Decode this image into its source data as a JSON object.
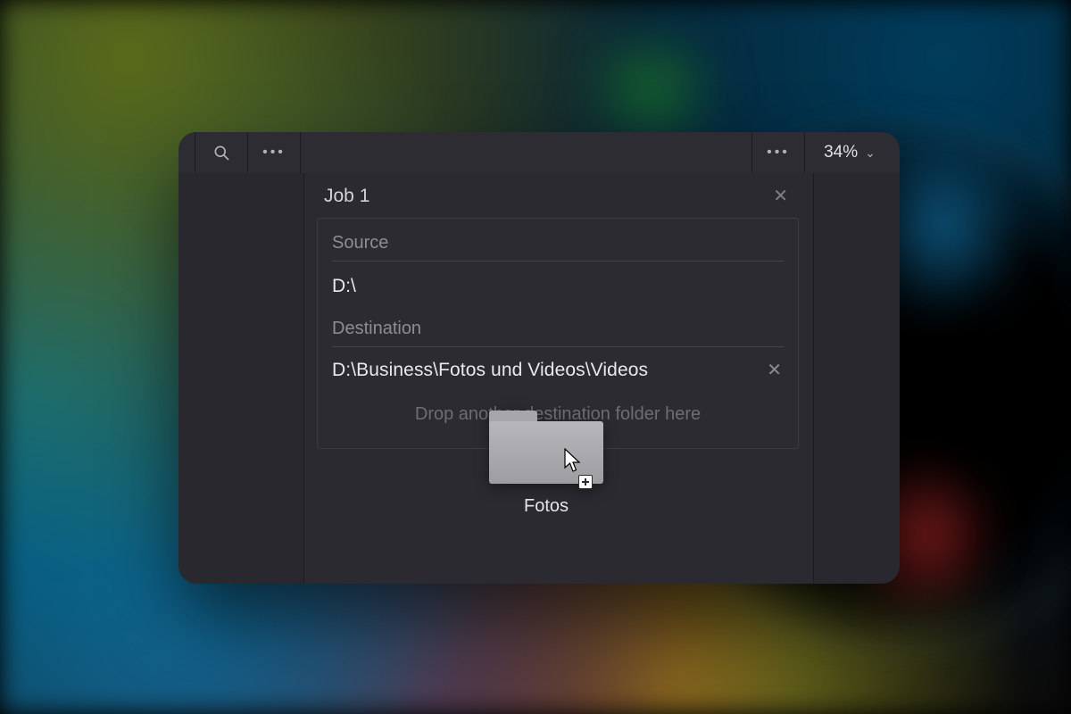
{
  "toolbar": {
    "zoom_label": "34%"
  },
  "job": {
    "title": "Job 1",
    "source_label": "Source",
    "source_path": "D:\\",
    "destination_label": "Destination",
    "destinations": [
      {
        "path": "D:\\Business\\Fotos und Videos\\Videos"
      }
    ],
    "drop_hint": "Drop another destination folder here"
  },
  "drag": {
    "item_label": "Fotos"
  }
}
